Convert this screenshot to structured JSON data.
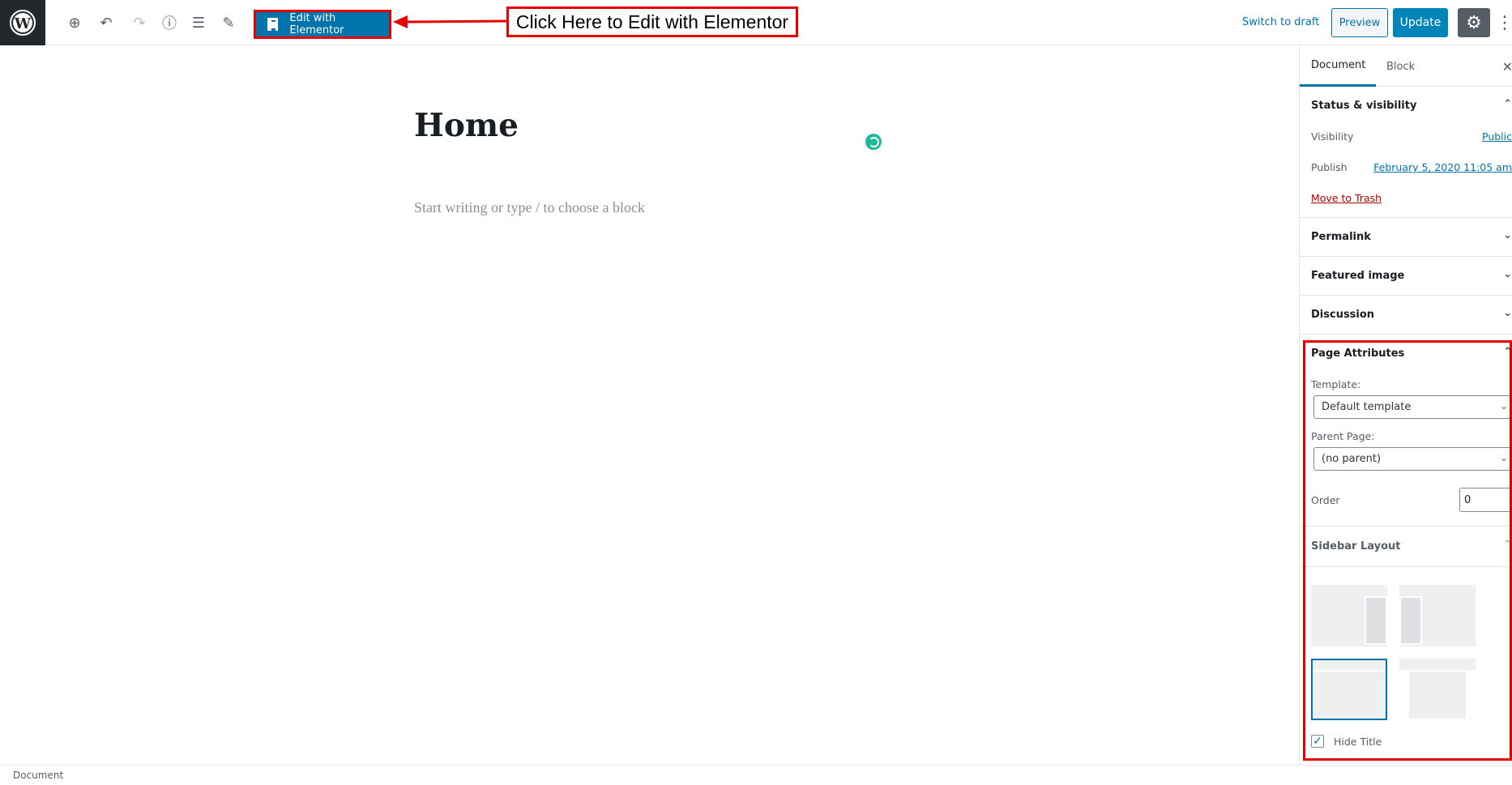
{
  "toolbar": {
    "wp_logo": "wordpress-logo",
    "icons": [
      "add-block-icon",
      "undo-icon",
      "redo-icon",
      "info-icon",
      "block-navigation-icon",
      "edit-tools-icon"
    ],
    "edit_elementor_label": "Edit with Elementor",
    "annotation": "Click Here to Edit with Elementor",
    "switch_draft": "Switch to draft",
    "preview": "Preview",
    "update": "Update",
    "settings_icon": "gear-icon",
    "more_icon": "more-vertical-icon"
  },
  "editor": {
    "title": "Home",
    "placeholder": "Start writing or type / to choose a block",
    "spinner_color": "#1fb99a"
  },
  "sidebar": {
    "tabs": [
      "Document",
      "Block"
    ],
    "status": {
      "heading": "Status & visibility",
      "visibility_label": "Visibility",
      "visibility_value": "Public",
      "publish_label": "Publish",
      "publish_value": "February 5, 2020 11:05 am",
      "trash": "Move to Trash"
    },
    "sections": [
      "Permalink",
      "Featured image",
      "Discussion"
    ],
    "page_attributes": {
      "heading": "Page Attributes",
      "template_label": "Template:",
      "template_value": "Default template",
      "parent_label": "Parent Page:",
      "parent_value": "(no parent)",
      "order_label": "Order",
      "order_value": "0"
    },
    "sidebar_layout": {
      "heading": "Sidebar Layout",
      "options": [
        "right-sidebar",
        "left-sidebar",
        "no-sidebar",
        "narrow-content"
      ],
      "selected": "no-sidebar",
      "hide_title_label": "Hide Title",
      "hide_title_checked": true
    }
  },
  "statusbar": {
    "label": "Document"
  },
  "colors": {
    "accent": "#0073aa",
    "annotation": "#e60000"
  }
}
